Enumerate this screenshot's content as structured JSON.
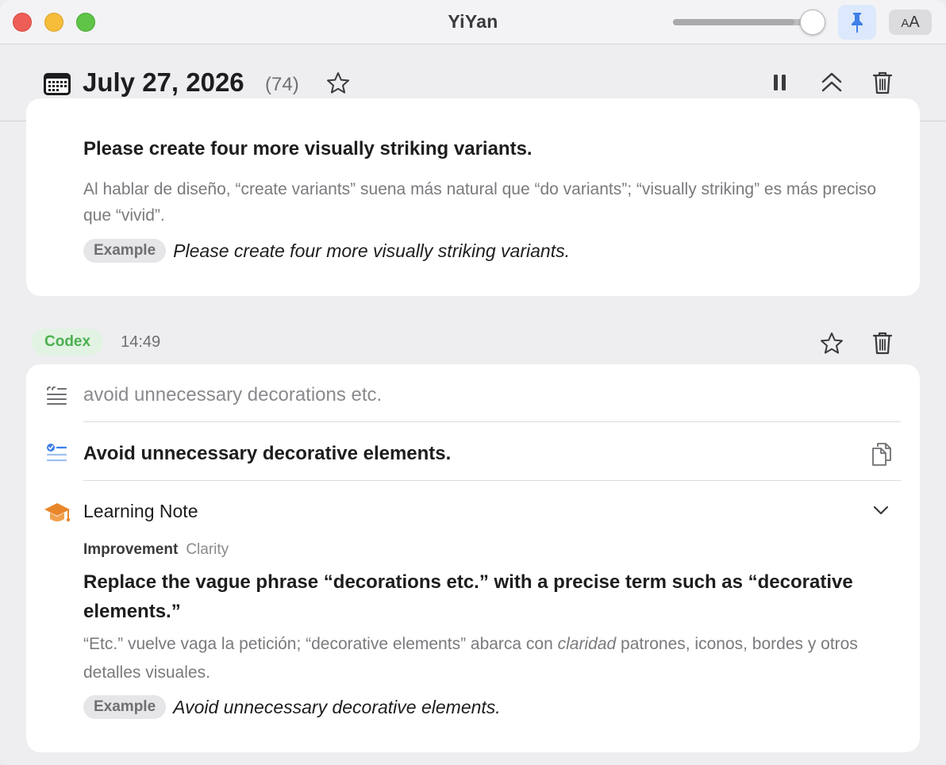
{
  "window": {
    "title": "YiYan",
    "opacity_slider_value": 0.9
  },
  "header": {
    "date": "July 27, 2026",
    "count": "(74)"
  },
  "card1": {
    "title": "Please create four more visually striking variants.",
    "explanation": "Al hablar de diseño, “create variants” suena más natural que “do variants”; “visually striking” es más preciso que “vivid”.",
    "example_label": "Example",
    "example_text": "Please create four more visually striking variants."
  },
  "entry2": {
    "source": "Codex",
    "time": "14:49",
    "original": "avoid unnecessary decorations etc.",
    "corrected": "Avoid unnecessary decorative elements.",
    "note_title": "Learning Note",
    "tag_primary": "Improvement",
    "tag_secondary": "Clarity",
    "note_heading": "Replace the vague phrase “decorations etc.” with a precise term such as “decorative elements.”",
    "note_expl_before": "“Etc.” vuelve vaga la petición; “decorative elements” abarca con ",
    "note_expl_em": "claridad",
    "note_expl_after": " patrones, iconos, bordes y otros detalles visuales.",
    "example_label": "Example",
    "example_text": "Avoid unnecessary decorative elements."
  },
  "colors": {
    "accent_blue": "#3d7fe8",
    "codex_green": "#4cb04f",
    "note_orange": "#e8862c"
  },
  "icons": [
    "calendar-icon",
    "star-icon",
    "pause-icon",
    "collapse-icon",
    "trash-icon",
    "pin-icon",
    "quote-icon",
    "checklist-icon",
    "copy-icon",
    "graduation-cap-icon",
    "chevron-down-icon"
  ]
}
